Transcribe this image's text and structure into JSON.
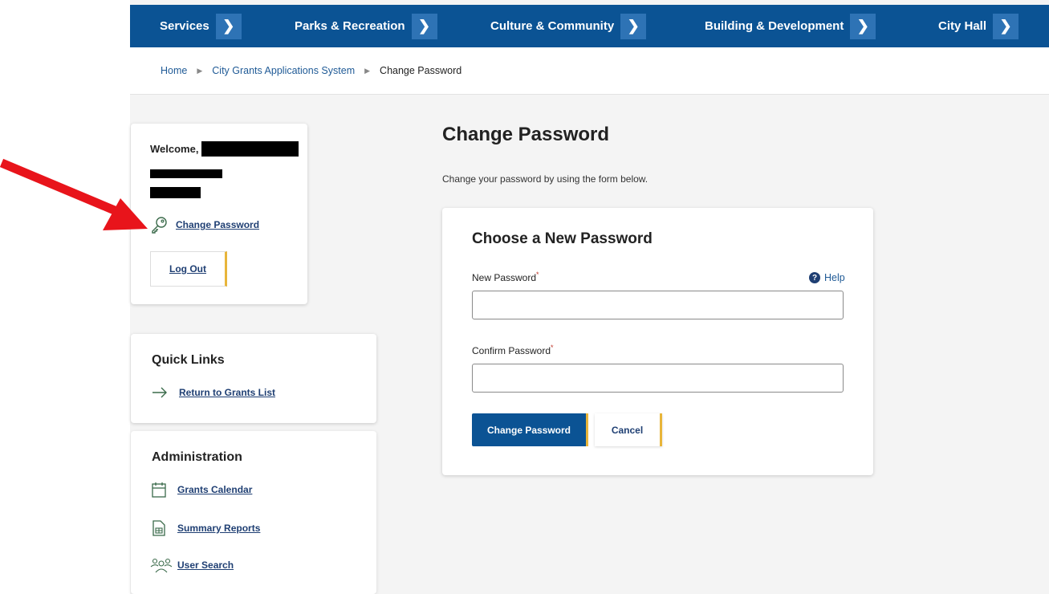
{
  "nav": {
    "items": [
      {
        "label": "Services"
      },
      {
        "label": "Parks & Recreation"
      },
      {
        "label": "Culture & Community"
      },
      {
        "label": "Building & Development"
      },
      {
        "label": "City Hall"
      }
    ]
  },
  "breadcrumb": {
    "home": "Home",
    "section": "City Grants Applications System",
    "current": "Change Password"
  },
  "welcome": {
    "greeting": "Welcome,",
    "change_password_link": "Change Password",
    "logout_label": "Log Out"
  },
  "quick_links": {
    "title": "Quick Links",
    "return_link": "Return to Grants List"
  },
  "administration": {
    "title": "Administration",
    "items": [
      {
        "label": "Grants Calendar",
        "icon": "calendar-icon"
      },
      {
        "label": "Summary Reports",
        "icon": "report-icon"
      },
      {
        "label": "User Search",
        "icon": "users-icon"
      }
    ]
  },
  "main": {
    "title": "Change Password",
    "description": "Change your password by using the form below."
  },
  "form": {
    "title": "Choose a New Password",
    "new_password_label": "New Password",
    "confirm_password_label": "Confirm Password",
    "required_marker": "*",
    "help_label": "Help",
    "help_badge": "?",
    "new_password_value": "",
    "confirm_password_value": "",
    "submit_label": "Change Password",
    "cancel_label": "Cancel"
  },
  "colors": {
    "nav_bg": "#0b5394",
    "accent": "#e8b53a",
    "annotation_arrow": "#e8141b"
  }
}
